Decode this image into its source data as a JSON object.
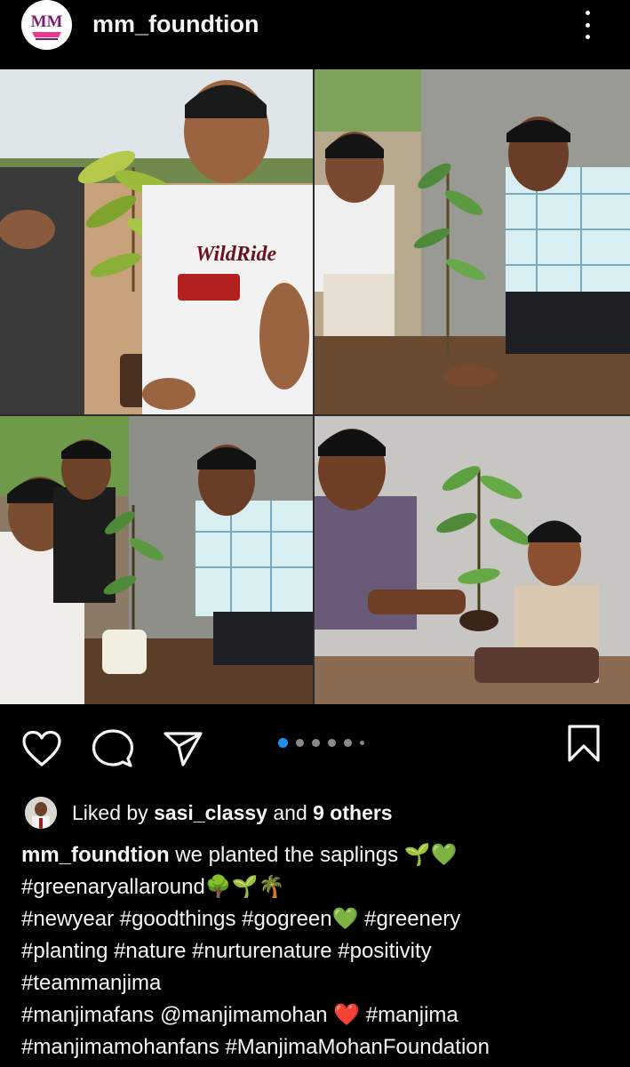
{
  "post": {
    "username": "mm_foundtion",
    "avatar_text": "MM",
    "more_icon": "more-vertical-icon"
  },
  "photo": {
    "panels": [
      "top-left",
      "top-right",
      "bottom-left",
      "bottom-right"
    ]
  },
  "carousel": {
    "count": 6,
    "active_index": 0
  },
  "actions": {
    "like_icon": "heart-icon",
    "comment_icon": "comment-icon",
    "share_icon": "send-icon",
    "save_icon": "bookmark-icon"
  },
  "likes": {
    "prefix": "Liked by",
    "liker": "sasi_classy",
    "conjunction": "and",
    "others": "9 others"
  },
  "caption": {
    "username": "mm_foundtion",
    "line1": " we planted the saplings 🌱💚",
    "line2": " #greenaryallaround🌳🌱🌴",
    "line3": "#newyear #goodthings #gogreen💚 #greenery",
    "line4": "#planting #nature  #nurturenature #positivity",
    "line5": "#teammanjima",
    "line6": "#manjimafans @manjimamohan ❤️ #manjima",
    "line7": "#manjimamohanfans #ManjimaMohanFoundation"
  },
  "colors": {
    "background": "#000000",
    "text": "#f5f5f5",
    "carousel_active": "#1f8fe8",
    "carousel_inactive": "#8a8a8a"
  }
}
